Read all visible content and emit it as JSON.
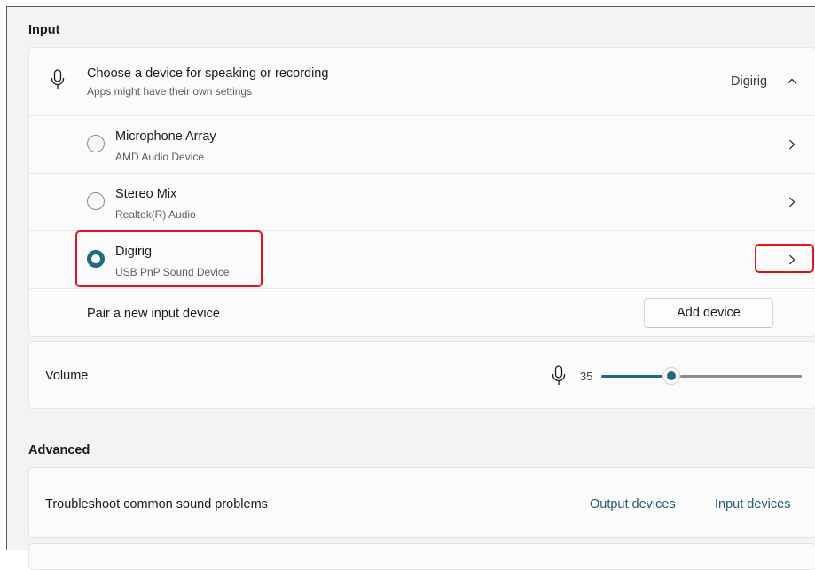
{
  "input_section": {
    "title": "Input",
    "device_chooser": {
      "title": "Choose a device for speaking or recording",
      "subtitle": "Apps might have their own settings",
      "selected_value": "Digirig",
      "icon": "microphone-icon",
      "expanded": true
    },
    "devices": [
      {
        "name": "Microphone Array",
        "subtitle": "AMD Audio Device",
        "selected": false
      },
      {
        "name": "Stereo Mix",
        "subtitle": "Realtek(R) Audio",
        "selected": false
      },
      {
        "name": "Digirig",
        "subtitle": "USB PnP Sound Device",
        "selected": true
      }
    ],
    "pair": {
      "label": "Pair a new input device",
      "button": "Add device"
    }
  },
  "volume": {
    "label": "Volume",
    "value": "35",
    "level_percent": 35,
    "icon": "microphone-icon"
  },
  "advanced_section": {
    "title": "Advanced",
    "troubleshoot": {
      "label": "Troubleshoot common sound problems",
      "links": [
        "Output devices",
        "Input devices"
      ]
    }
  },
  "colors": {
    "accent": "#1f6a7b",
    "highlight_box": "#e0151b",
    "link": "#1f5d73"
  }
}
